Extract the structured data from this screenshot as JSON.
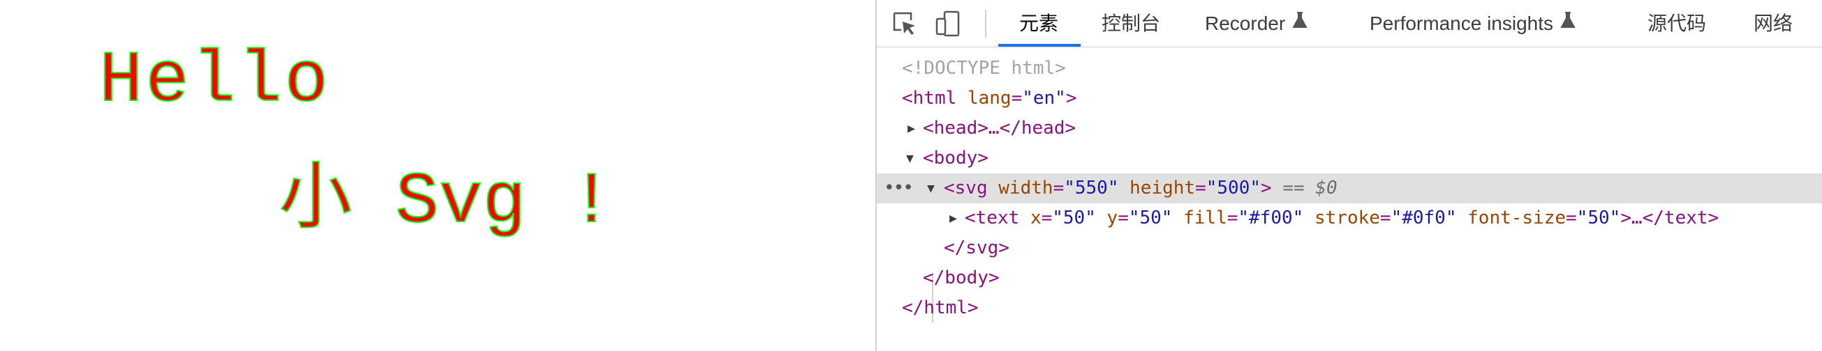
{
  "viewport": {
    "line1": "Hello",
    "line2": "小 Svg !",
    "fill_color": "#ff0000",
    "stroke_color": "#00ff00"
  },
  "devtools": {
    "tabs": [
      {
        "label": "元素",
        "active": true
      },
      {
        "label": "控制台",
        "active": false
      },
      {
        "label": "Recorder",
        "experimental": true
      },
      {
        "label": "Performance insights",
        "experimental": true
      },
      {
        "label": "源代码",
        "active": false
      },
      {
        "label": "网络",
        "active": false
      }
    ],
    "icons": [
      "select-element-icon",
      "device-toolbar-icon",
      "flask-icon"
    ],
    "tree": {
      "doctype": "<!DOCTYPE html>",
      "html_open_tag": "<html",
      "html_attr_lang": "lang",
      "html_attr_lang_val": "\"en\"",
      "html_close_bracket": ">",
      "head_collapsed": "<head>…</head>",
      "body_open": "<body>",
      "svg_tag": "<svg",
      "svg_attr_width": "width",
      "svg_attr_width_val": "\"550\"",
      "svg_attr_height": "height",
      "svg_attr_height_val": "\"500\"",
      "svg_close_bracket": ">",
      "selected_marker": "== $0",
      "text_tag": "<text",
      "text_attr_x": "x",
      "text_attr_x_val": "\"50\"",
      "text_attr_y": "y",
      "text_attr_y_val": "\"50\"",
      "text_attr_fill": "fill",
      "text_attr_fill_val": "\"#f00\"",
      "text_attr_stroke": "stroke",
      "text_attr_stroke_val": "\"#0f0\"",
      "text_attr_fontsize": "font-size",
      "text_attr_fontsize_val": "\"50\"",
      "text_close": ">…</text>",
      "svg_close": "</svg>",
      "body_close": "</body>",
      "html_close": "</html>",
      "dots": "•••"
    }
  }
}
